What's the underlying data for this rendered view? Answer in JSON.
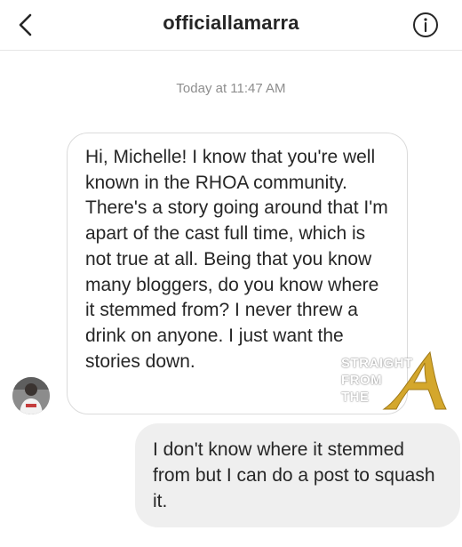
{
  "header": {
    "username": "officiallamarra",
    "back_icon": "chevron-left-icon",
    "info_icon": "info-circle-icon"
  },
  "thread": {
    "timestamp": "Today at 11:47 AM",
    "messages": [
      {
        "direction": "incoming",
        "text": "Hi, Michelle! I know that you're well known in the RHOA community. There's a story going around that I'm apart of the cast full time, which is not true at all. Being that you know many bloggers, do you know where it stemmed from? I never threw a drink on anyone. I just want the stories down."
      },
      {
        "direction": "outgoing",
        "text": "I don't know where it stemmed from but I can do a post to squash it."
      }
    ]
  },
  "watermark": {
    "line1": "STRAIGHT",
    "line2": "FROM",
    "line3": "THE",
    "letter": "A"
  },
  "colors": {
    "incoming_border": "#dbdbdb",
    "outgoing_bg": "#efefef",
    "timestamp": "#8e8e8e",
    "watermark_gold": "#d4a72c"
  }
}
